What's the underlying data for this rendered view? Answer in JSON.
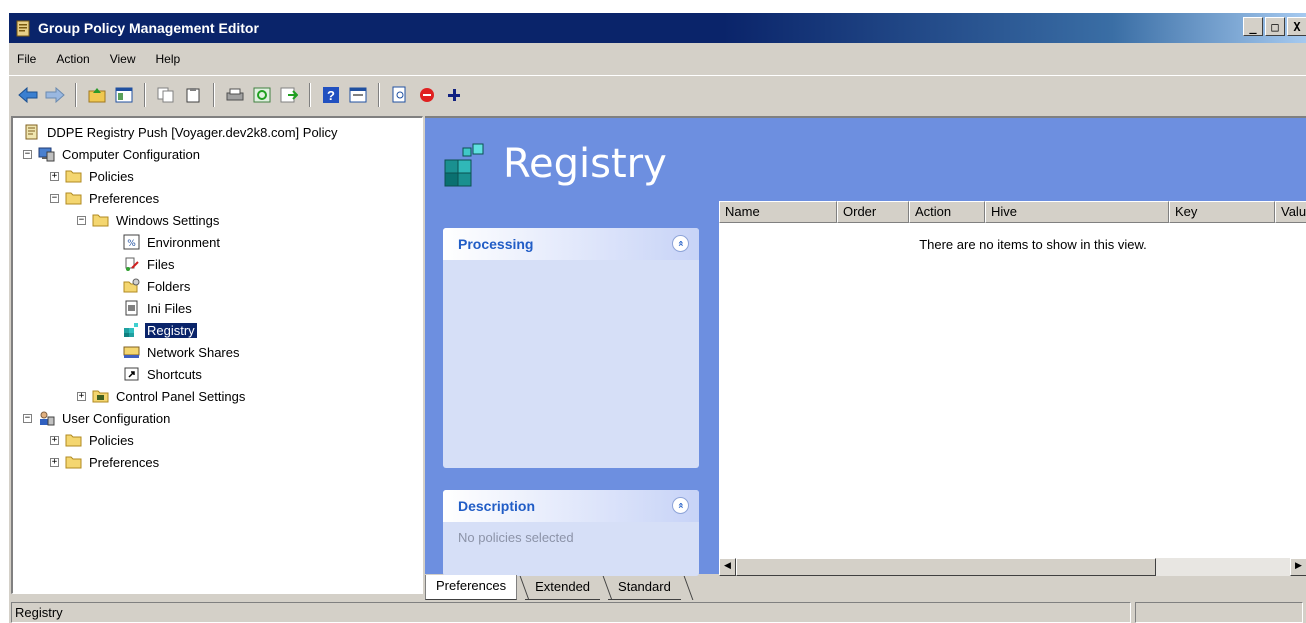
{
  "window": {
    "title": "Group Policy Management Editor",
    "controls": {
      "minimize": "_",
      "restore": "□",
      "close": "X"
    }
  },
  "menu": [
    "File",
    "Action",
    "View",
    "Help"
  ],
  "toolbar": {
    "icons": [
      "back-icon",
      "forward-icon",
      "up-folder-icon",
      "show-hide-tree-icon",
      "copy-icon",
      "paste-icon",
      "print-icon",
      "refresh-icon",
      "export-icon",
      "help-icon",
      "properties-icon",
      "new-item-icon",
      "stop-icon",
      "add-icon"
    ]
  },
  "tree": {
    "root": "DDPE Registry Push [Voyager.dev2k8.com] Policy",
    "computer_config": "Computer Configuration",
    "cc_policies": "Policies",
    "cc_preferences": "Preferences",
    "windows_settings": "Windows Settings",
    "environment": "Environment",
    "files": "Files",
    "folders": "Folders",
    "ini_files": "Ini Files",
    "registry": "Registry",
    "network_shares": "Network Shares",
    "shortcuts": "Shortcuts",
    "control_panel": "Control Panel Settings",
    "user_config": "User Configuration",
    "uc_policies": "Policies",
    "uc_preferences": "Preferences"
  },
  "content": {
    "heading": "Registry",
    "processing_title": "Processing",
    "description_title": "Description",
    "description_text": "No policies selected",
    "columns": [
      "Name",
      "Order",
      "Action",
      "Hive",
      "Key",
      "Valu"
    ],
    "empty_message": "There are no items to show in this view.",
    "collapse_glyph": "«"
  },
  "tabs": [
    "Preferences",
    "Extended",
    "Standard"
  ],
  "status": {
    "text": "Registry"
  },
  "colors": {
    "title_bar": "#0a246a",
    "pane_background": "#6d8fe0",
    "panel_title": "#215dc6"
  }
}
